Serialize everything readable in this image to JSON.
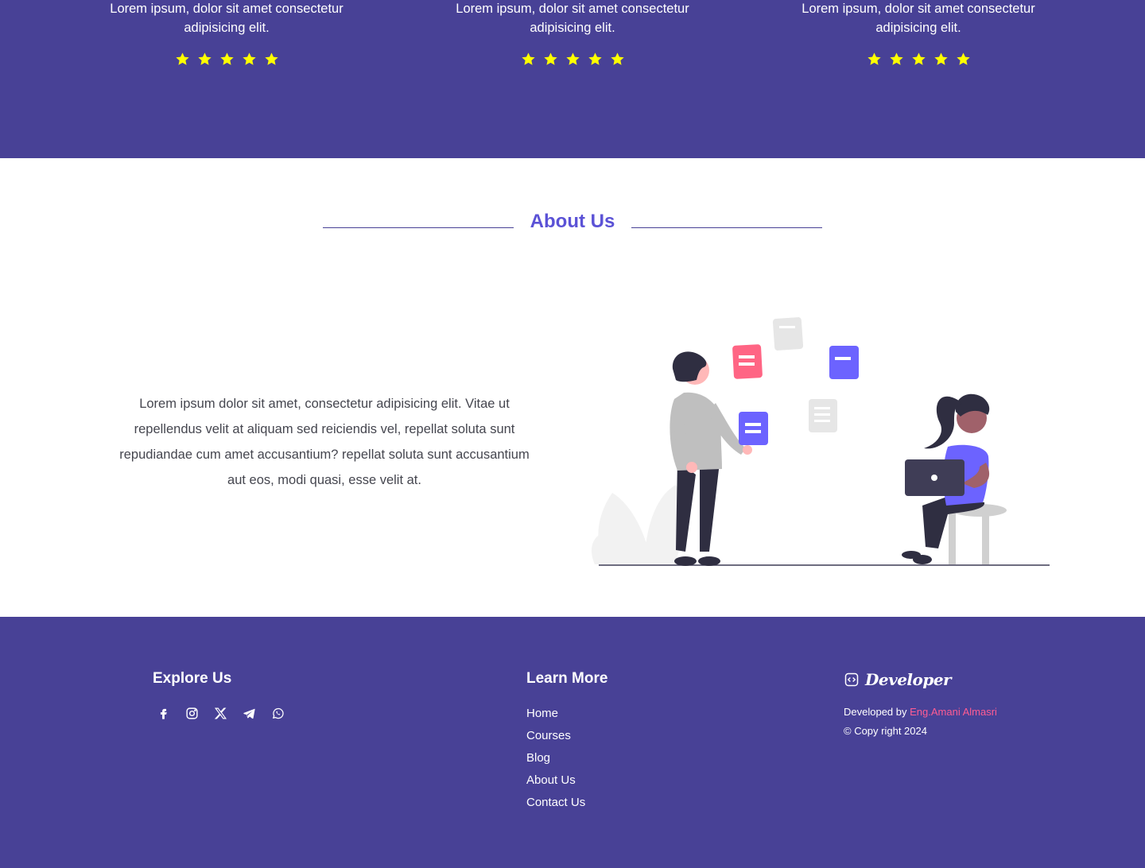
{
  "colors": {
    "band": "#484196",
    "accent": "#5b52d6",
    "star": "#ffff00",
    "author": "#ff5c93"
  },
  "testimonials": [
    {
      "text_line1": "Lorem ipsum, dolor sit amet consectetur",
      "text_line2": "adipisicing elit.",
      "rating": 5
    },
    {
      "text_line1": "Lorem ipsum, dolor sit amet consectetur",
      "text_line2": "adipisicing elit.",
      "rating": 5
    },
    {
      "text_line1": "Lorem ipsum, dolor sit amet consectetur",
      "text_line2": "adipisicing elit.",
      "rating": 5
    }
  ],
  "about": {
    "title": "About Us",
    "text": "Lorem ipsum dolor sit amet, consectetur adipisicing elit. Vitae ut repellendus velit at aliquam sed reiciendis vel, repellat soluta sunt repudiandae cum amet accusantium? repellat soluta sunt accusantium aut eos, modi quasi, esse velit at."
  },
  "footer": {
    "explore": {
      "heading": "Explore Us",
      "socials": [
        "facebook-icon",
        "instagram-icon",
        "x-twitter-icon",
        "telegram-icon",
        "whatsapp-icon"
      ]
    },
    "learn": {
      "heading": "Learn More",
      "links": [
        "Home",
        "Courses",
        "Blog",
        "About Us",
        "Contact Us"
      ]
    },
    "developer": {
      "brand": "Developer",
      "credit_prefix": "Developed by",
      "author": "Eng.Amani Almasri",
      "copyright": "© Copy right 2024"
    }
  }
}
